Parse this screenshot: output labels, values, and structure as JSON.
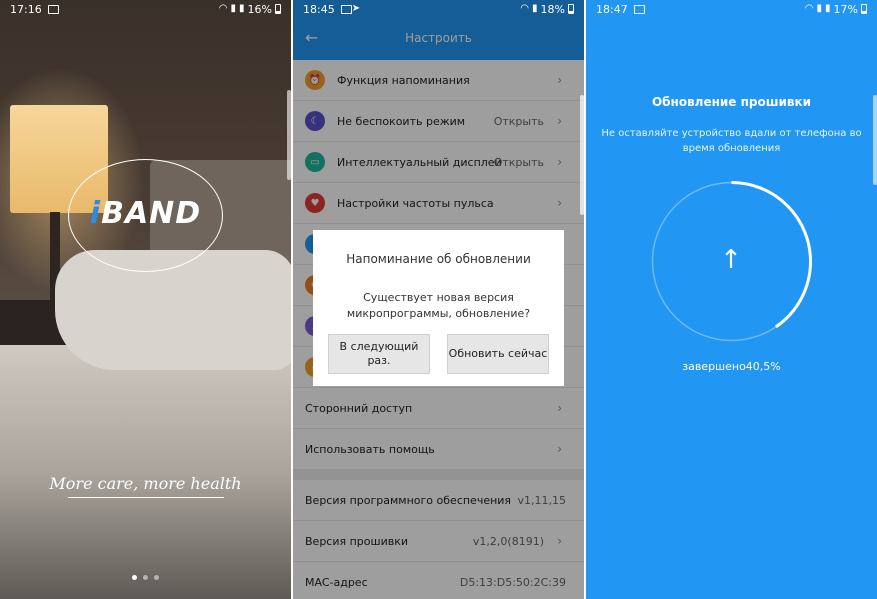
{
  "screens": [
    {
      "status": {
        "time": "17:16",
        "battery": "16%"
      },
      "brand": {
        "prefix": "i",
        "rest": "BAND"
      },
      "tagline": "More care, more health",
      "pager": {
        "count": 3,
        "active": 0
      }
    },
    {
      "status": {
        "time": "18:45",
        "battery": "18%"
      },
      "appbar": {
        "title": "Настроить"
      },
      "menu_items": [
        {
          "label": "Функция напоминания",
          "value": "",
          "icon": "alarm-icon",
          "color": "#f0a22e"
        },
        {
          "label": "Не беспокоить режим",
          "value": "Открыть",
          "icon": "moon-icon",
          "color": "#5b4fcf"
        },
        {
          "label": "Интеллектуальный дисплей",
          "value": "Открыть",
          "icon": "display-icon",
          "color": "#1fb89a"
        },
        {
          "label": "Настройки частоты пульса",
          "value": "",
          "icon": "heart-icon",
          "color": "#e23b3b"
        },
        {
          "label": "",
          "value": "",
          "icon": "info-icon",
          "color": "#2196f3"
        },
        {
          "label": "",
          "value": "",
          "icon": "settings-icon",
          "color": "#ef7d22"
        },
        {
          "label": "",
          "value": "",
          "icon": "bell-icon",
          "color": "#7a5cd6"
        },
        {
          "label": "",
          "value": "",
          "icon": "cup-icon",
          "color": "#f0a22e"
        }
      ],
      "menu_items_2": [
        {
          "label": "Сторонний доступ",
          "value": ""
        },
        {
          "label": "Использовать помощь",
          "value": ""
        }
      ],
      "info_items": [
        {
          "label": "Версия программного обеспечения",
          "value": "v1,11,15"
        },
        {
          "label": "Версия прошивки",
          "value": "v1,2,0(8191)"
        },
        {
          "label": "MAC-адрес",
          "value": "D5:13:D5:50:2C:39"
        }
      ],
      "dialog": {
        "title": "Напоминание об обновлении",
        "message": "Существует новая версия микропрограммы, обновление?",
        "later_label": "В следующий раз.",
        "update_label": "Обновить сейчас"
      }
    },
    {
      "status": {
        "time": "18:47",
        "battery": "17%"
      },
      "title": "Обновление прошивки",
      "description": "Не оставляйте устройство вдали от телефона во время обновления",
      "progress_text": "завершено40,5%",
      "progress_fraction": 0.405
    }
  ],
  "colors": {
    "accent": "#2196f3",
    "brand_i": "#2b8ce6"
  }
}
